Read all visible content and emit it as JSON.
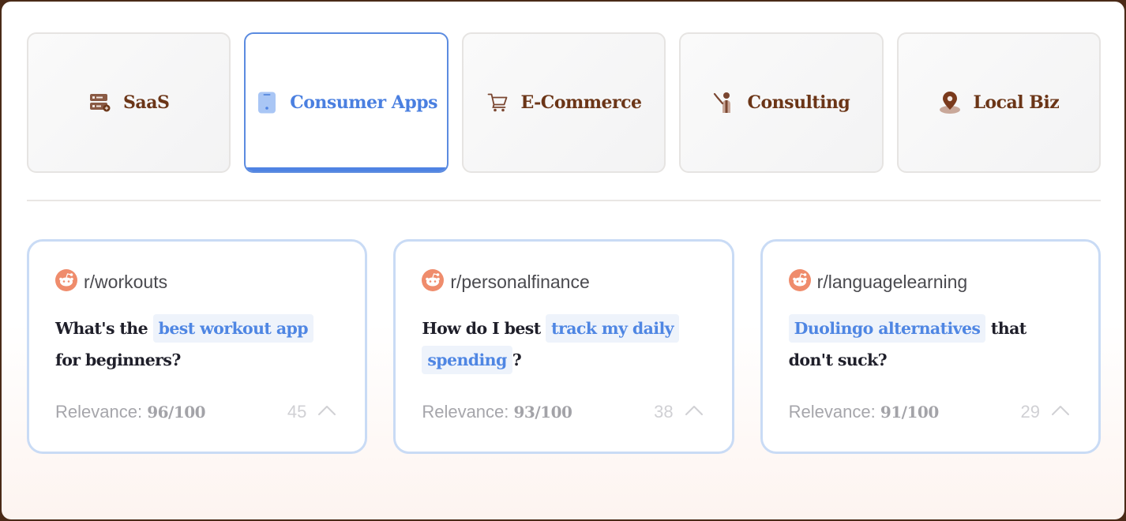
{
  "tabs": [
    {
      "label": "SaaS",
      "icon": "server-icon",
      "active": false
    },
    {
      "label": "Consumer Apps",
      "icon": "mobile-phone-icon",
      "active": true
    },
    {
      "label": "E-Commerce",
      "icon": "shopping-cart-icon",
      "active": false
    },
    {
      "label": "Consulting",
      "icon": "person-presenting-icon",
      "active": false
    },
    {
      "label": "Local Biz",
      "icon": "map-pin-icon",
      "active": false
    }
  ],
  "cards": [
    {
      "subreddit": "r/workouts",
      "question": {
        "pre": "What's the ",
        "highlight": "best workout app",
        "post": " for beginners?"
      },
      "relevance_label": "Relevance: ",
      "relevance_value": "96/100",
      "votes": "45"
    },
    {
      "subreddit": "r/personalfinance",
      "question": {
        "pre": "How do I best ",
        "highlight": "track my daily spending",
        "post": "?"
      },
      "relevance_label": "Relevance: ",
      "relevance_value": "93/100",
      "votes": "38"
    },
    {
      "subreddit": "r/languagelearning",
      "question": {
        "pre": "",
        "highlight": "Duolingo alternatives",
        "post": " that don't suck?"
      },
      "relevance_label": "Relevance: ",
      "relevance_value": "91/100",
      "votes": "29"
    }
  ],
  "colors": {
    "accent": "#4f83e3",
    "tab_text": "#6b3517",
    "card_border": "#c9dbf5",
    "highlight_bg": "#eef3fb",
    "reddit_icon": "#ef8c6c"
  }
}
